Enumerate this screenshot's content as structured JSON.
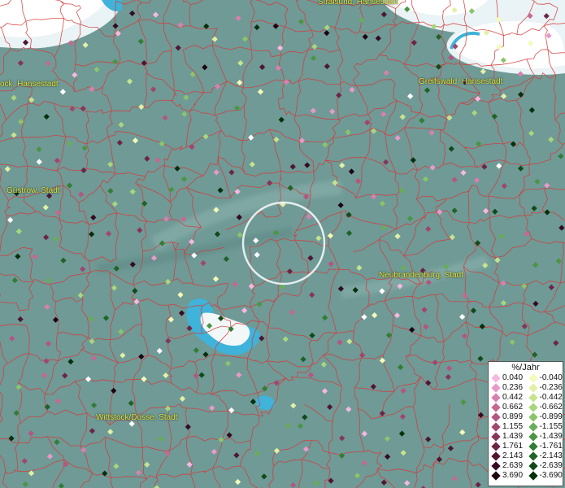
{
  "map": {
    "cities": [
      {
        "id": "stralsund",
        "label": "Stralsund, Hansestadt"
      },
      {
        "id": "rostock",
        "label": "ock, Hansestadt"
      },
      {
        "id": "greifswald",
        "label": "Greifswald, Hansestadt"
      },
      {
        "id": "guestrow",
        "label": "Güstrow, Stadt"
      },
      {
        "id": "neubrandenburg",
        "label": "Neubrandenburg, Stadt"
      },
      {
        "id": "wittstock",
        "label": "Wittstock/Dosse, Stadt"
      }
    ],
    "selection_circle": {
      "name": "selection-ring"
    }
  },
  "colors": {
    "land": "#6f9a96",
    "water": "#3fb3d9",
    "cloud": "#f2f7f8",
    "border": "#d63a3a"
  },
  "legend": {
    "title": "%/Jahr",
    "rows": [
      {
        "pos": "0.040",
        "pos_color": "#f6b8e0",
        "neg": "-0.040",
        "neg_color": "#f4fbb8"
      },
      {
        "pos": "0.236",
        "pos_color": "#e79ac6",
        "neg": "-0.236",
        "neg_color": "#e2f0a6"
      },
      {
        "pos": "0.442",
        "pos_color": "#d880ad",
        "neg": "-0.442",
        "neg_color": "#c6e48e"
      },
      {
        "pos": "0.662",
        "pos_color": "#c46992",
        "neg": "-0.662",
        "neg_color": "#a9d67c"
      },
      {
        "pos": "0.899",
        "pos_color": "#b35681",
        "neg": "-0.899",
        "neg_color": "#8ac46b"
      },
      {
        "pos": "1.155",
        "pos_color": "#a0466f",
        "neg": "-1.155",
        "neg_color": "#68ad57"
      },
      {
        "pos": "1.439",
        "pos_color": "#86355a",
        "neg": "-1.439",
        "neg_color": "#4a9644"
      },
      {
        "pos": "1.761",
        "pos_color": "#6c2547",
        "neg": "-1.761",
        "neg_color": "#327d34"
      },
      {
        "pos": "2.143",
        "pos_color": "#4f1633",
        "neg": "-2.143",
        "neg_color": "#1f6326"
      },
      {
        "pos": "2.639",
        "pos_color": "#340b22",
        "neg": "-2.639",
        "neg_color": "#114a18"
      },
      {
        "pos": "3.690",
        "pos_color": "#1c0412",
        "neg": "-3.690",
        "neg_color": "#06300c"
      }
    ]
  }
}
